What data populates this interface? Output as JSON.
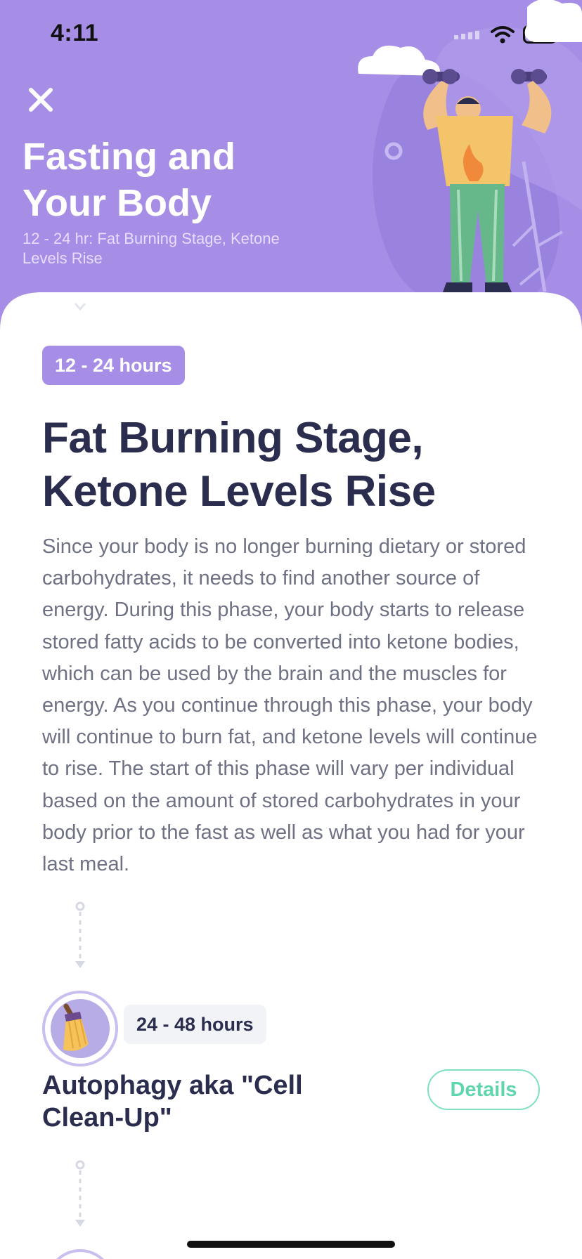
{
  "status_bar": {
    "time": "4:11"
  },
  "header": {
    "title": "Fasting and Your Body",
    "subtitle": "12 - 24 hr: Fat Burning Stage, Ketone Levels Rise"
  },
  "current_stage": {
    "time_range": "12 - 24 hours",
    "title": "Fat Burning Stage, Ketone Levels Rise",
    "description": "Since your body is no longer burning dietary or stored carbohydrates, it needs to find another source of energy. During this phase, your body starts to release stored fatty acids to be converted into ketone bodies, which can be used by the brain and the muscles for energy. As you continue through this phase, your body will continue to burn fat, and ketone levels will continue to rise. The start of this phase will vary per individual based on the amount of stored carbohydrates in your body prior to the fast as well as what you had for your last meal."
  },
  "next_stage": {
    "time_range": "24 - 48 hours",
    "title": "Autophagy aka \"Cell Clean-Up\"",
    "details_label": "Details",
    "icon": "broom-icon"
  },
  "colors": {
    "header_bg": "#a68ee6",
    "title_text": "#2b2d4e",
    "body_text": "#6e7184",
    "accent_green": "#5fd6ac"
  }
}
